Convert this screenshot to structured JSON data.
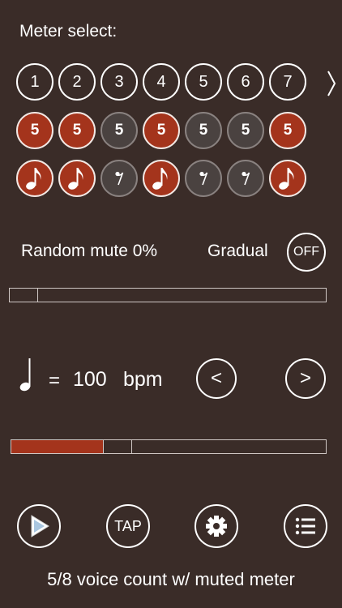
{
  "meter_select": {
    "label": "Meter select:",
    "numbers": [
      "1",
      "2",
      "3",
      "4",
      "5",
      "6",
      "7"
    ],
    "beats": [
      {
        "value": "5",
        "active": true
      },
      {
        "value": "5",
        "active": true
      },
      {
        "value": "5",
        "active": false
      },
      {
        "value": "5",
        "active": true
      },
      {
        "value": "5",
        "active": false
      },
      {
        "value": "5",
        "active": false
      },
      {
        "value": "5",
        "active": true
      }
    ],
    "notes": [
      {
        "icon": "eighth-note-icon",
        "active": true
      },
      {
        "icon": "eighth-note-icon",
        "active": true
      },
      {
        "icon": "eighth-rest-icon",
        "active": false
      },
      {
        "icon": "eighth-note-icon",
        "active": true
      },
      {
        "icon": "eighth-rest-icon",
        "active": false
      },
      {
        "icon": "eighth-rest-icon",
        "active": false
      },
      {
        "icon": "eighth-note-icon",
        "active": true
      }
    ],
    "more_icon": "chevron-right-icon"
  },
  "random_mute": {
    "label": "Random mute 0%",
    "value_percent": 0
  },
  "gradual": {
    "label": "Gradual",
    "toggle_label": "OFF"
  },
  "tempo": {
    "note_icon": "quarter-note-icon",
    "equals": "=",
    "value": "100",
    "unit": "bpm",
    "decrement_label": "<",
    "increment_label": ">"
  },
  "progress": {
    "fill_fraction": 0.29
  },
  "controls": {
    "play_icon": "play-icon",
    "tap_label": "TAP",
    "settings_icon": "gear-icon",
    "list_icon": "list-icon"
  },
  "status_text": "5/8 voice count w/ muted meter",
  "colors": {
    "background": "#3a2c28",
    "accent": "#a4341c",
    "inactive": "#4a4240"
  }
}
